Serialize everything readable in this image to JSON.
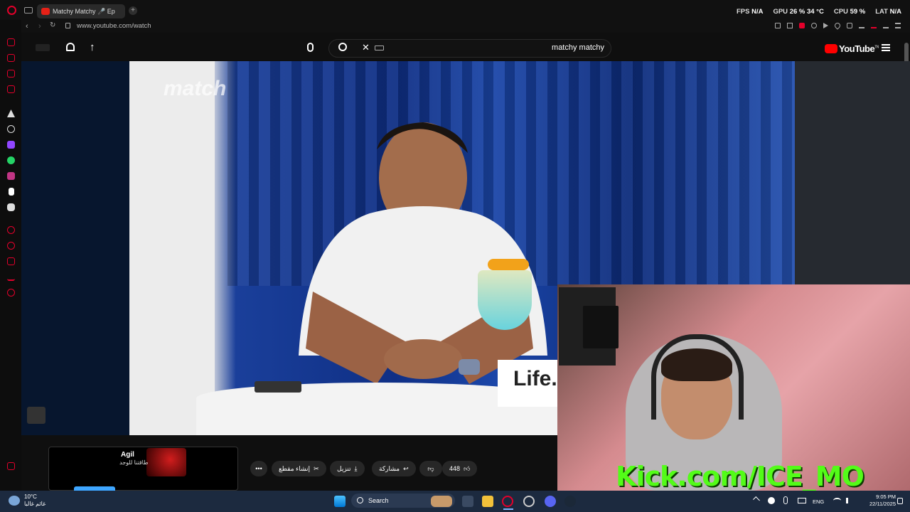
{
  "browser": {
    "tab_title": "Matchy Matchy 🎤 Ep",
    "new_tab": "+",
    "url": "www.youtube.com/watch",
    "stats": {
      "fps_label": "FPS",
      "fps_value": "N/A",
      "gpu_label": "GPU",
      "gpu_value": "26 % 34 °C",
      "cpu_label": "CPU",
      "cpu_value": "59 %",
      "lat_label": "LAT",
      "lat_value": "N/A"
    }
  },
  "youtube": {
    "search_query": "matchy matchy",
    "logo_text": "YouTube",
    "logo_suffix": "TN"
  },
  "video": {
    "watermark": "match",
    "card_text": "Life."
  },
  "actions": {
    "likes": "448",
    "share": "مشاركة",
    "download": "تنزيل",
    "clip": "إنشاء مقطع"
  },
  "ad": {
    "title": "Agil",
    "subtitle": "طاقتنا للوجد"
  },
  "overlay": {
    "kick_text": "Kick.com/ICE_MO"
  },
  "taskbar": {
    "temperature": "10°C",
    "weather_text": "غائم غالبا",
    "search_label": "Search",
    "language": "ENG",
    "time": "9:05 PM",
    "date": "22/11/2025"
  },
  "colors": {
    "kick_green": "#53fc18",
    "youtube_red": "#ff0000",
    "opera_red": "#e4002b"
  }
}
